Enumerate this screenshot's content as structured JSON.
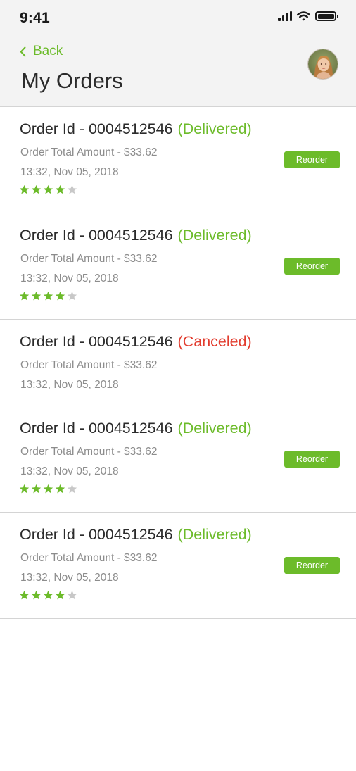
{
  "status_bar": {
    "time": "9:41"
  },
  "header": {
    "back_label": "Back",
    "title": "My Orders"
  },
  "colors": {
    "accent": "#6cbb2a",
    "canceled": "#e23c2e",
    "star_empty": "#c8c8c8",
    "muted_text": "#8c8c8c"
  },
  "orders": [
    {
      "title": "Order Id - 0004512546",
      "status": "(Delivered)",
      "status_kind": "delivered",
      "amount": "Order Total Amount - $33.62",
      "datetime": "13:32, Nov 05, 2018",
      "rating": 4,
      "rating_max": 5,
      "reorder_label": "Reorder"
    },
    {
      "title": "Order Id - 0004512546",
      "status": "(Delivered)",
      "status_kind": "delivered",
      "amount": "Order Total Amount - $33.62",
      "datetime": "13:32, Nov 05, 2018",
      "rating": 4,
      "rating_max": 5,
      "reorder_label": "Reorder"
    },
    {
      "title": "Order Id - 0004512546",
      "status": "(Canceled)",
      "status_kind": "canceled",
      "amount": "Order Total Amount - $33.62",
      "datetime": "13:32, Nov 05, 2018"
    },
    {
      "title": "Order Id - 0004512546",
      "status": "(Delivered)",
      "status_kind": "delivered",
      "amount": "Order Total Amount - $33.62",
      "datetime": "13:32, Nov 05, 2018",
      "rating": 4,
      "rating_max": 5,
      "reorder_label": "Reorder"
    },
    {
      "title": "Order Id - 0004512546",
      "status": "(Delivered)",
      "status_kind": "delivered",
      "amount": "Order Total Amount - $33.62",
      "datetime": "13:32, Nov 05, 2018",
      "rating": 4,
      "rating_max": 5,
      "reorder_label": "Reorder"
    }
  ]
}
